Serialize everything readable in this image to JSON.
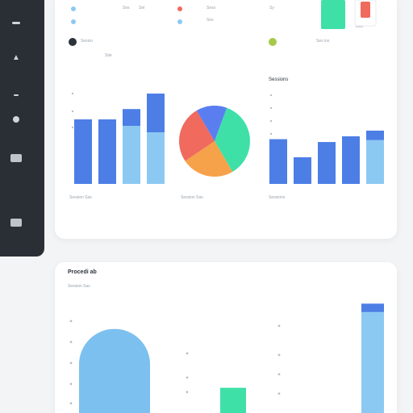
{
  "colors": {
    "sidebar": "#2a2f36",
    "blue_dark": "#4c7ee6",
    "blue_light": "#8cc9f2",
    "red": "#f06a5e",
    "teal": "#3ee0a8",
    "orange": "#f6a24a",
    "pie_blue": "#5a7ef0",
    "olive": "#a7c94a",
    "black_dot": "#2d333b"
  },
  "sidebar": {
    "items": [
      {
        "icon": "menu-icon"
      },
      {
        "icon": "dashboard-icon"
      },
      {
        "icon": "divider-icon"
      },
      {
        "icon": "settings-icon"
      },
      {
        "icon": "reports-icon"
      },
      {
        "icon": "users-icon"
      }
    ]
  },
  "top_card": {
    "header_small": {
      "a": "Ses",
      "b": "Sel",
      "c": "Sess",
      "d": "Ses",
      "e": "Sy",
      "f": "Stas"
    },
    "bar_chart_1": {
      "legend_label": "Sessio",
      "legend_sub": "Sde",
      "caption": "Session Sas"
    },
    "pie_chart": {
      "caption": "Session Sas"
    },
    "bar_chart_2": {
      "legend_label": "Ses ios",
      "title": "Sessions",
      "caption": "Sessions"
    }
  },
  "bottom_card": {
    "title": "Procedi ab",
    "subtitle": "Session Sas"
  },
  "chart_data": [
    {
      "type": "bar",
      "series": [
        {
          "values": [
            5,
            5,
            4.5,
            4
          ]
        },
        {
          "values": [
            0,
            0,
            1.3,
            3
          ]
        }
      ],
      "categories": [
        "",
        "",
        "",
        ""
      ],
      "ylim": [
        0,
        8
      ]
    },
    {
      "type": "pie",
      "slices": [
        {
          "value": 36,
          "color": "#3ee0a8"
        },
        {
          "value": 24,
          "color": "#f6a24a"
        },
        {
          "value": 26,
          "color": "#f06a5e"
        },
        {
          "value": 14,
          "color": "#5a7ef0"
        }
      ]
    },
    {
      "type": "bar",
      "series": [
        {
          "values": [
            4.7,
            2.8,
            4.4,
            5,
            4.6
          ]
        },
        {
          "values": [
            0,
            0,
            0,
            0,
            1
          ]
        }
      ],
      "categories": [
        "",
        "",
        "",
        "",
        ""
      ],
      "ylim": [
        0,
        10
      ]
    },
    {
      "type": "bar",
      "series": [
        {
          "values": [
            10,
            3,
            12
          ]
        },
        {
          "values": [
            0,
            0,
            1
          ]
        }
      ],
      "categories": [
        "",
        "",
        ""
      ],
      "ylim": [
        0,
        14
      ]
    }
  ]
}
